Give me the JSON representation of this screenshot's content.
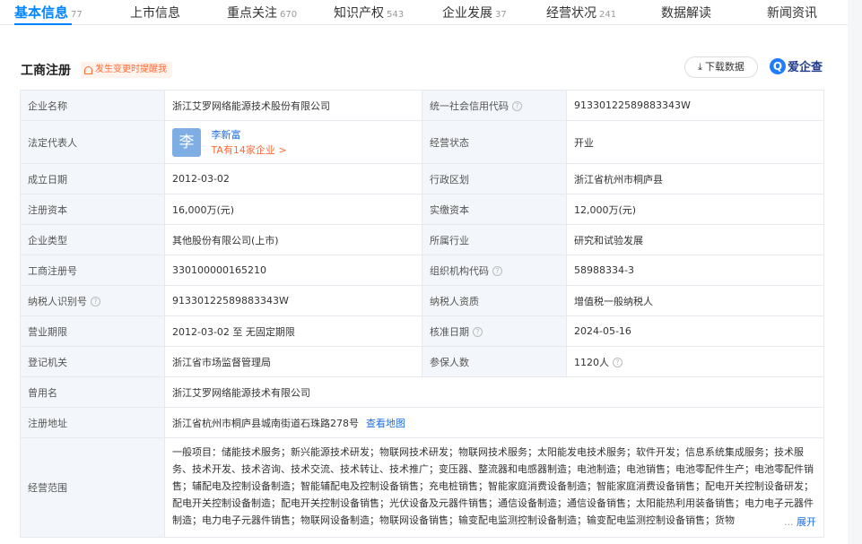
{
  "tabs": [
    {
      "label": "基本信息",
      "count": "77"
    },
    {
      "label": "上市信息",
      "count": ""
    },
    {
      "label": "重点关注",
      "count": "670"
    },
    {
      "label": "知识产权",
      "count": "543"
    },
    {
      "label": "企业发展",
      "count": "37"
    },
    {
      "label": "经营状况",
      "count": "241"
    },
    {
      "label": "数据解读",
      "count": ""
    },
    {
      "label": "新闻资讯",
      "count": ""
    }
  ],
  "section": {
    "title": "工商注册",
    "change_tip": "发生变更时提醒我",
    "download": "下载数据",
    "brand": "爱企查"
  },
  "rows": {
    "company_name": {
      "label": "企业名称",
      "value": "浙江艾罗网络能源技术股份有限公司"
    },
    "credit_code": {
      "label": "统一社会信用代码",
      "value": "91330122589883343W"
    },
    "legal_rep": {
      "label": "法定代表人",
      "avatar": "李",
      "name": "李新富",
      "more": "TA有14家企业 >"
    },
    "status": {
      "label": "经营状态",
      "value": "开业"
    },
    "established": {
      "label": "成立日期",
      "value": "2012-03-02"
    },
    "region": {
      "label": "行政区划",
      "value": "浙江省杭州市桐庐县"
    },
    "reg_capital": {
      "label": "注册资本",
      "value": "16,000万(元)"
    },
    "paid_capital": {
      "label": "实缴资本",
      "value": "12,000万(元)"
    },
    "company_type": {
      "label": "企业类型",
      "value": "其他股份有限公司(上市)"
    },
    "industry": {
      "label": "所属行业",
      "value": "研究和试验发展"
    },
    "reg_number": {
      "label": "工商注册号",
      "value": "330100000165210"
    },
    "org_code": {
      "label": "组织机构代码",
      "value": "58988334-3"
    },
    "tax_id": {
      "label": "纳税人识别号",
      "value": "91330122589883343W"
    },
    "taxpayer_type": {
      "label": "纳税人资质",
      "value": "增值税一般纳税人"
    },
    "term": {
      "label": "营业期限",
      "value": "2012-03-02 至 无固定期限"
    },
    "approval_date": {
      "label": "核准日期",
      "value": "2024-05-16"
    },
    "authority": {
      "label": "登记机关",
      "value": "浙江省市场监督管理局"
    },
    "insured": {
      "label": "参保人数",
      "value": "1120人"
    },
    "former_name": {
      "label": "曾用名",
      "value": "浙江艾罗网络能源技术有限公司"
    },
    "address": {
      "label": "注册地址",
      "value": "浙江省杭州市桐庐县城南街道石珠路278号",
      "map_link": "查看地图"
    },
    "scope": {
      "label": "经营范围",
      "value": "一般项目：储能技术服务；新兴能源技术研发；物联网技术研发；物联网技术服务；太阳能发电技术服务；软件开发；信息系统集成服务；技术服务、技术开发、技术咨询、技术交流、技术转让、技术推广；变压器、整流器和电感器制造；电池制造；电池销售；电池零配件生产；电池零配件销售；辅配电及控制设备制造；智能辅配电及控制设备销售；充电桩销售；智能家庭消费设备制造；智能家庭消费设备销售；配电开关控制设备研发；配电开关控制设备制造；配电开关控制设备销售；光伏设备及元器件销售；通信设备制造；通信设备销售；太阳能热利用装备销售；电力电子元器件制造；电力电子元器件销售；物联网设备制造；物联网设备销售；输变配电监测控制设备制造；输变配电监测控制设备销售；货物",
      "ellipsis": "...",
      "expand": "展开"
    }
  }
}
